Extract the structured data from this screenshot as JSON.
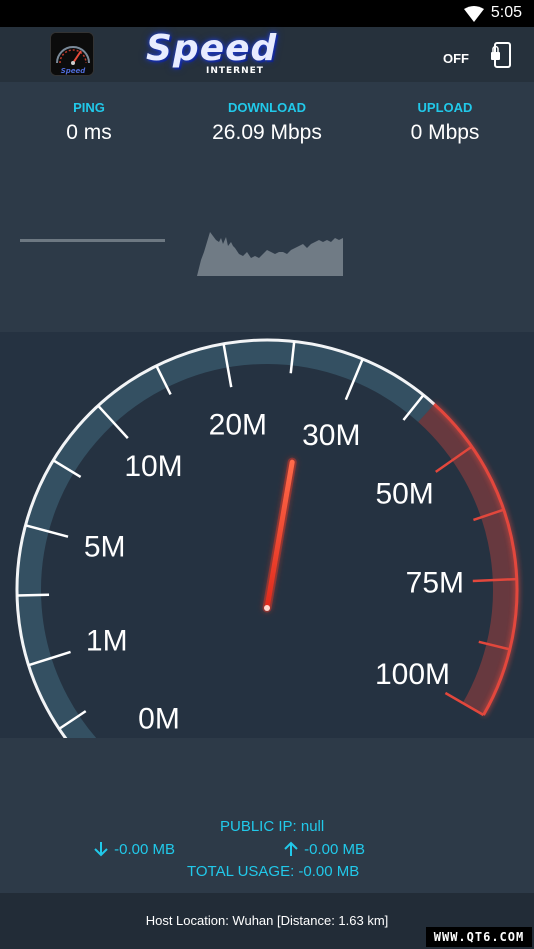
{
  "status_bar": {
    "time": "5:05",
    "wifi_icon": "wifi-icon"
  },
  "app_bar": {
    "brand_word": "Speed",
    "brand_sub": "INTERNET",
    "toggle_label": "OFF",
    "lock_icon": "phone-lock-icon"
  },
  "stats": {
    "ping": {
      "label": "PING",
      "value": "0 ms"
    },
    "download": {
      "label": "DOWNLOAD",
      "value": "26.09 Mbps"
    },
    "upload": {
      "label": "UPLOAD",
      "value": "0 Mbps"
    }
  },
  "gauge": {
    "labels": [
      "0M",
      "1M",
      "5M",
      "10M",
      "20M",
      "30M",
      "50M",
      "75M",
      "100M"
    ],
    "needle_value_mbps": 26.09,
    "accent_color": "#21c9ea",
    "danger_color": "#e2473c"
  },
  "usage": {
    "public_ip": "PUBLIC IP: null",
    "download_total": "-0.00 MB",
    "upload_total": "-0.00 MB",
    "total_usage": "TOTAL USAGE: -0.00 MB"
  },
  "footer": {
    "host_location": "Host Location: Wuhan [Distance: 1.63 km]",
    "watermark": "WWW.QT6.COM"
  }
}
